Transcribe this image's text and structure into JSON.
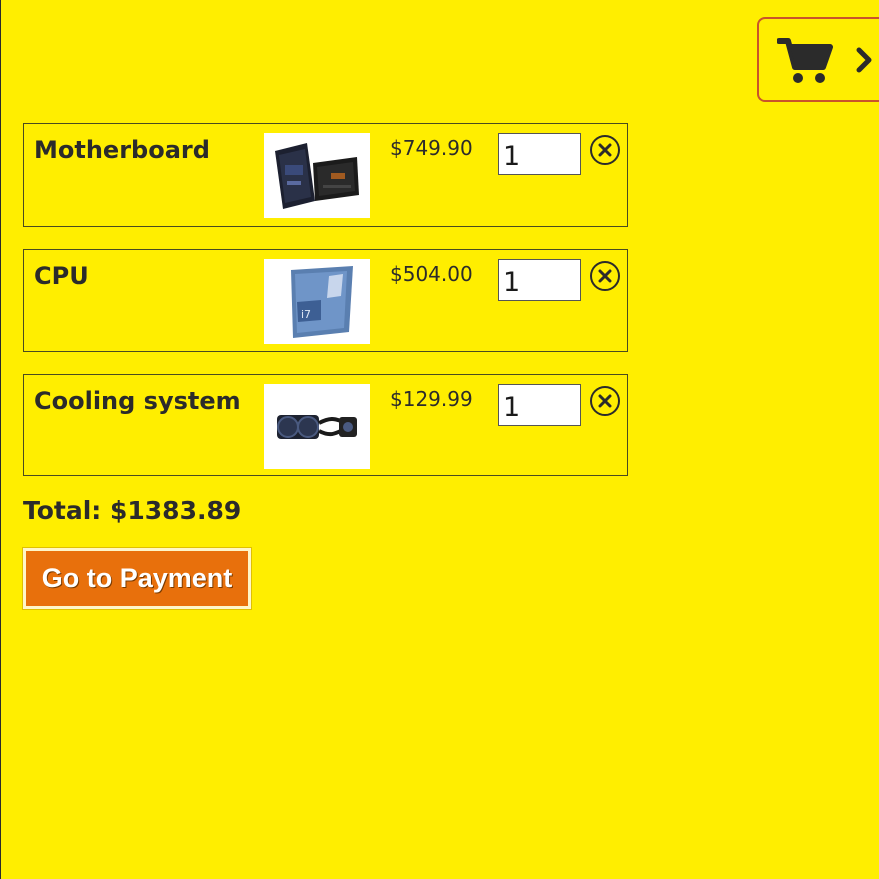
{
  "cart_toggle": {
    "icon": "shopping-cart-icon",
    "chevron": "chevron-right-icon"
  },
  "items": [
    {
      "name": "Motherboard",
      "price": "$749.90",
      "quantity": "1",
      "thumb": "motherboard-box-image"
    },
    {
      "name": "CPU",
      "price": "$504.00",
      "quantity": "1",
      "thumb": "cpu-box-image"
    },
    {
      "name": "Cooling system",
      "price": "$129.99",
      "quantity": "1",
      "thumb": "cooler-image"
    }
  ],
  "total_label": "Total: $1383.89",
  "pay_button_label": "Go to Payment",
  "colors": {
    "background": "#ffee00",
    "button": "#e8700c",
    "text": "#2b2b2b"
  }
}
